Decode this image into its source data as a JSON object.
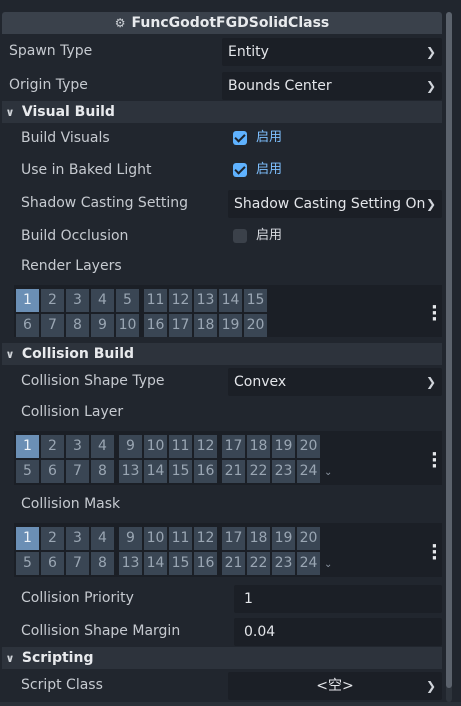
{
  "inspector": {
    "class_title": "FuncGodotFGDSolidClass",
    "spawn_type": {
      "label": "Spawn Type",
      "value": "Entity"
    },
    "origin_type": {
      "label": "Origin Type",
      "value": "Bounds Center"
    },
    "visual_build": {
      "title": "Visual Build",
      "build_visuals": {
        "label": "Build Visuals",
        "checked": true,
        "text": "启用"
      },
      "use_in_baked_light": {
        "label": "Use in Baked Light",
        "checked": true,
        "text": "启用"
      },
      "shadow_casting": {
        "label": "Shadow Casting Setting",
        "value": "Shadow Casting Setting On"
      },
      "build_occlusion": {
        "label": "Build Occlusion",
        "checked": false,
        "text": "启用"
      },
      "render_layers": {
        "label": "Render Layers",
        "selected": [
          1
        ]
      }
    },
    "collision_build": {
      "title": "Collision Build",
      "shape_type": {
        "label": "Collision Shape Type",
        "value": "Convex"
      },
      "collision_layer": {
        "label": "Collision Layer",
        "selected": [
          1
        ]
      },
      "collision_mask": {
        "label": "Collision Mask",
        "selected": [
          1
        ]
      },
      "priority": {
        "label": "Collision Priority",
        "value": "1"
      },
      "shape_margin": {
        "label": "Collision Shape Margin",
        "value": "0.04"
      }
    },
    "scripting": {
      "title": "Scripting",
      "script_class": {
        "label": "Script Class",
        "value": "<空>"
      }
    }
  },
  "layer_numbers": {
    "render": {
      "row1": [
        "1",
        "2",
        "3",
        "4",
        "5",
        "11",
        "12",
        "13",
        "14",
        "15"
      ],
      "row2": [
        "6",
        "7",
        "8",
        "9",
        "10",
        "16",
        "17",
        "18",
        "19",
        "20"
      ]
    },
    "physics": {
      "row1": [
        "1",
        "2",
        "3",
        "4",
        "9",
        "10",
        "11",
        "12",
        "17",
        "18",
        "19",
        "20"
      ],
      "row2": [
        "5",
        "6",
        "7",
        "8",
        "13",
        "14",
        "15",
        "16",
        "21",
        "22",
        "23",
        "24"
      ]
    }
  },
  "icons": {
    "class": "node-icon",
    "expand": "chevron-down-icon",
    "dropdown": "chevron-down-icon",
    "menu": "vertical-dots-icon"
  },
  "colors": {
    "accent": "#5fb2ff",
    "enabled_text": "#7ec0ff",
    "layer_selected": "#6b8fb5",
    "layer_cell": "#3a4654",
    "panel_bg": "#21262e"
  }
}
